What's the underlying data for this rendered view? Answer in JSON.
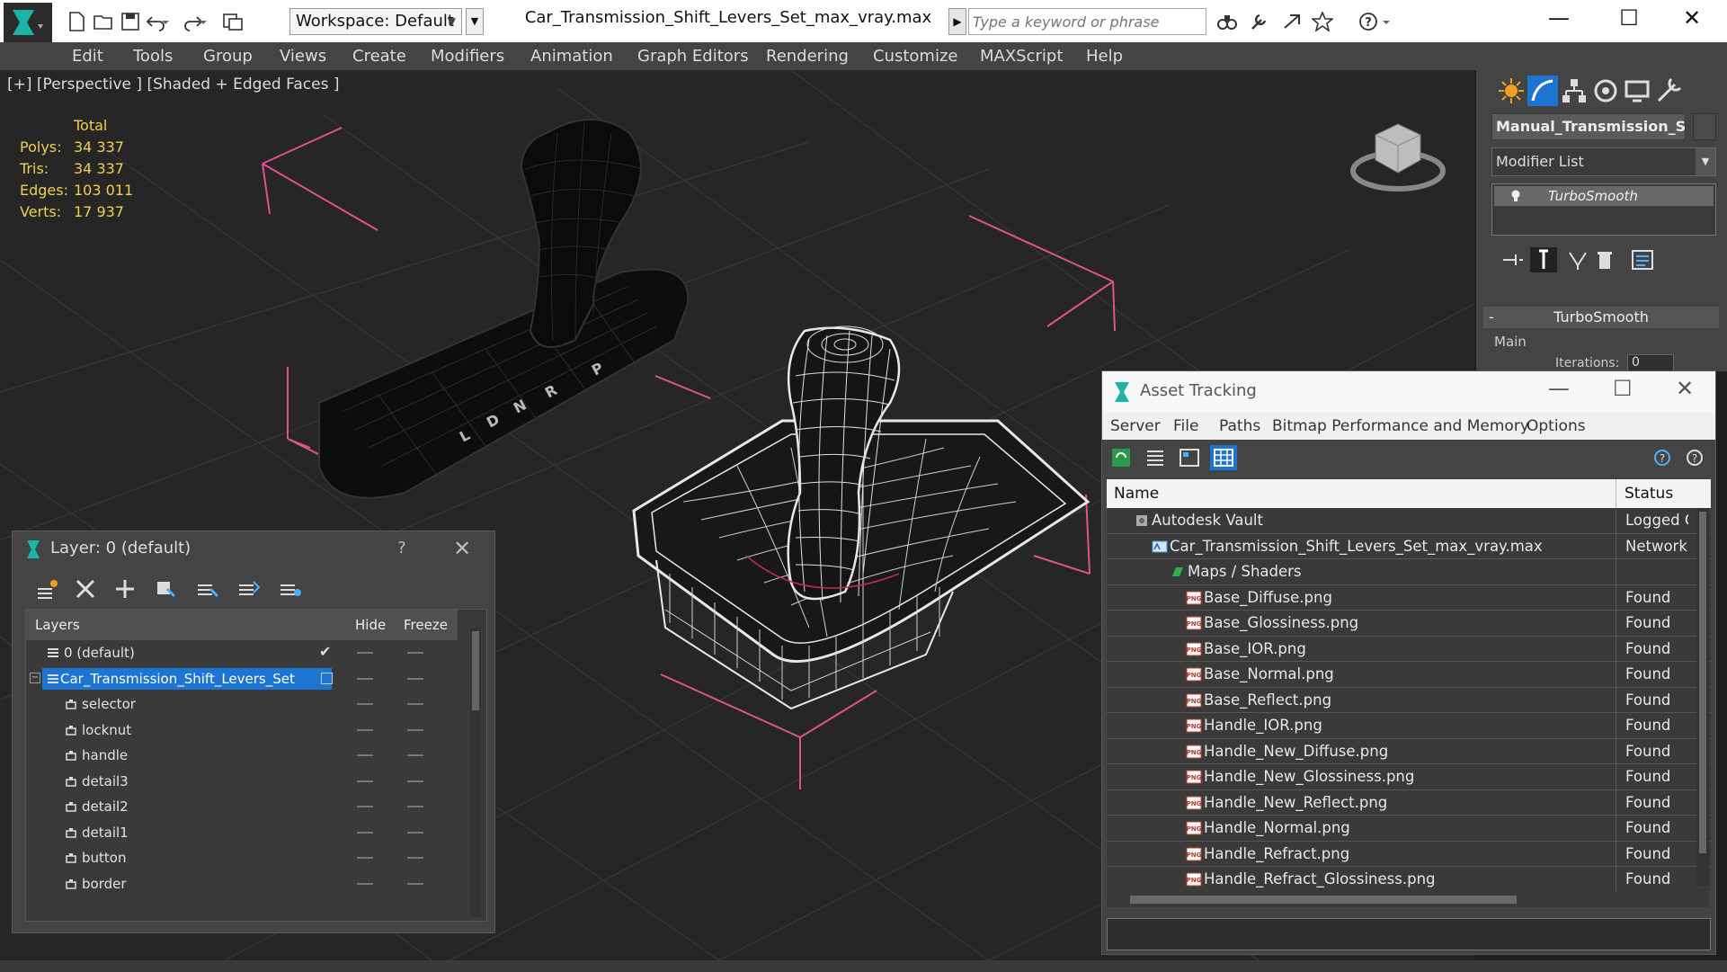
{
  "window": {
    "title": "Car_Transmission_Shift_Levers_Set_max_vray.max",
    "workspace": "Workspace: Default",
    "search_placeholder": "Type a keyword or phrase",
    "minimize": "—",
    "maximize": "☐",
    "close": "✕"
  },
  "menubar": [
    "Edit",
    "Tools",
    "Group",
    "Views",
    "Create",
    "Modifiers",
    "Animation",
    "Graph Editors",
    "Rendering",
    "Customize",
    "MAXScript",
    "Help"
  ],
  "viewport": {
    "label": "[+] [Perspective ] [Shaded + Edged Faces ]",
    "stats": {
      "header": "Total",
      "rows": [
        {
          "label": "Polys:",
          "value": "34 337"
        },
        {
          "label": "Tris:",
          "value": "34 337"
        },
        {
          "label": "Edges:",
          "value": "103 011"
        },
        {
          "label": "Verts:",
          "value": "17 937"
        }
      ]
    },
    "gear_letters": [
      "P",
      "R",
      "N",
      "D",
      "L"
    ]
  },
  "command_panel": {
    "object_name": "Manual_Transmission_Shift_",
    "modifier_list": "Modifier List",
    "stack_item": "TurboSmooth",
    "rollout_title": "TurboSmooth",
    "rollout_minus": "-",
    "main_label": "Main",
    "iterations_label": "Iterations:",
    "iterations_value": "0"
  },
  "layer_window": {
    "title": "Layer: 0 (default)",
    "help": "?",
    "close": "✕",
    "columns": {
      "layers": "Layers",
      "hide": "Hide",
      "freeze": "Freeze"
    },
    "rows": [
      {
        "name": "0 (default)",
        "indent": 1,
        "type": "layer",
        "checked": true
      },
      {
        "name": "Car_Transmission_Shift_Levers_Set",
        "indent": 1,
        "type": "layer",
        "selected": true
      },
      {
        "name": "selector",
        "indent": 2,
        "type": "object"
      },
      {
        "name": "locknut",
        "indent": 2,
        "type": "object"
      },
      {
        "name": "handle",
        "indent": 2,
        "type": "object"
      },
      {
        "name": "detail3",
        "indent": 2,
        "type": "object"
      },
      {
        "name": "detail2",
        "indent": 2,
        "type": "object"
      },
      {
        "name": "detail1",
        "indent": 2,
        "type": "object"
      },
      {
        "name": "button",
        "indent": 2,
        "type": "object"
      },
      {
        "name": "border",
        "indent": 2,
        "type": "object"
      }
    ]
  },
  "asset_window": {
    "title": "Asset Tracking",
    "menu": [
      "Server",
      "File",
      "Paths",
      "Bitmap Performance and Memory",
      "Options"
    ],
    "columns": {
      "name": "Name",
      "status": "Status"
    },
    "rows": [
      {
        "name": "Autodesk Vault",
        "status": "Logged O",
        "level": 1,
        "icon": "vault"
      },
      {
        "name": "Car_Transmission_Shift_Levers_Set_max_vray.max",
        "status": "Network",
        "level": 2,
        "icon": "max"
      },
      {
        "name": "Maps / Shaders",
        "status": "",
        "level": 3,
        "icon": "maps"
      },
      {
        "name": "Base_Diffuse.png",
        "status": "Found",
        "level": 4,
        "icon": "png"
      },
      {
        "name": "Base_Glossiness.png",
        "status": "Found",
        "level": 4,
        "icon": "png"
      },
      {
        "name": "Base_IOR.png",
        "status": "Found",
        "level": 4,
        "icon": "png"
      },
      {
        "name": "Base_Normal.png",
        "status": "Found",
        "level": 4,
        "icon": "png"
      },
      {
        "name": "Base_Reflect.png",
        "status": "Found",
        "level": 4,
        "icon": "png"
      },
      {
        "name": "Handle_IOR.png",
        "status": "Found",
        "level": 4,
        "icon": "png"
      },
      {
        "name": "Handle_New_Diffuse.png",
        "status": "Found",
        "level": 4,
        "icon": "png"
      },
      {
        "name": "Handle_New_Glossiness.png",
        "status": "Found",
        "level": 4,
        "icon": "png"
      },
      {
        "name": "Handle_New_Reflect.png",
        "status": "Found",
        "level": 4,
        "icon": "png"
      },
      {
        "name": "Handle_Normal.png",
        "status": "Found",
        "level": 4,
        "icon": "png"
      },
      {
        "name": "Handle_Refract.png",
        "status": "Found",
        "level": 4,
        "icon": "png"
      },
      {
        "name": "Handle_Refract_Glossiness.png",
        "status": "Found",
        "level": 4,
        "icon": "png"
      }
    ]
  },
  "colors": {
    "accent": "#1e74d2",
    "stats_text": "#f0d050",
    "bbox_pink": "#e0528a",
    "viewport_bg": "#262626"
  }
}
